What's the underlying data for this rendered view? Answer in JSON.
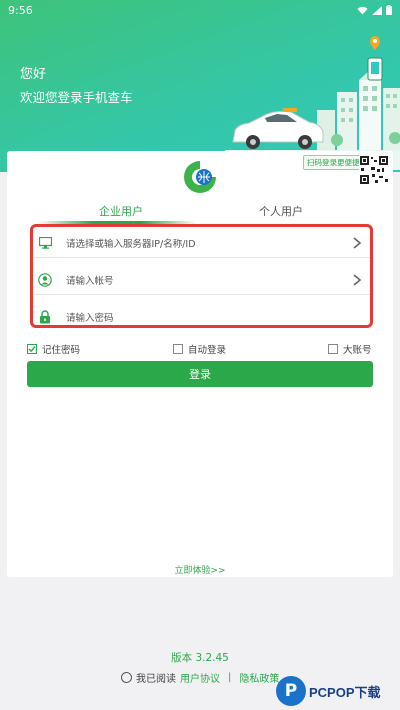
{
  "status": {
    "time": "9:56"
  },
  "header": {
    "greeting": "您好",
    "welcome": "欢迎您登录手机查车"
  },
  "card": {
    "scan_tip": "扫码登录更便捷",
    "tabs": [
      {
        "label": "企业用户",
        "active": true
      },
      {
        "label": "个人用户",
        "active": false
      }
    ],
    "fields": {
      "server_placeholder": "请选择或输入服务器IP/名称/ID",
      "account_placeholder": "请输入帐号",
      "password_placeholder": "请输入密码"
    },
    "options": {
      "remember": "记住密码",
      "auto_login": "自动登录",
      "big_account": "大账号"
    },
    "login_label": "登录",
    "try_label": "立即体验>>"
  },
  "footer": {
    "version": "版本  3.2.45",
    "read_label": "我已阅读",
    "agreement": "用户协议",
    "separator": "|",
    "privacy": "隐私政策"
  },
  "watermark": {
    "letter": "P",
    "text": "PCPOP下载"
  },
  "colors": {
    "brand_green": "#2aa84a",
    "header_start": "#3ec37a",
    "header_end": "#2ec9bf",
    "highlight_red": "#e53935"
  }
}
